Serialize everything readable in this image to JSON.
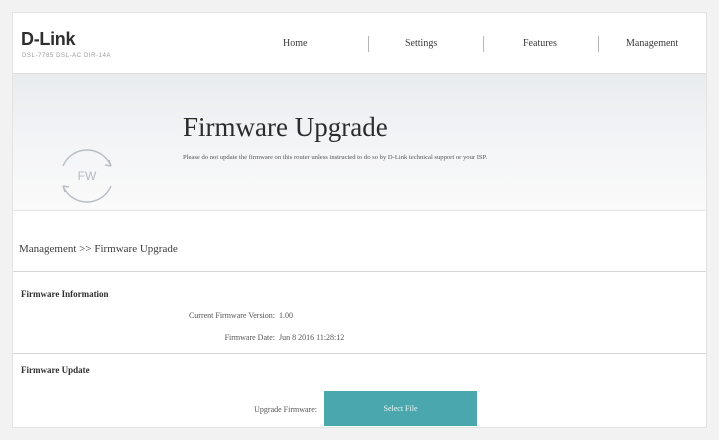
{
  "header": {
    "logo": "D-Link",
    "model": "DSL-7785 DSL-AC DIR-14A",
    "nav": [
      "Home",
      "Settings",
      "Features",
      "Management"
    ]
  },
  "hero": {
    "icon_label": "FW",
    "title": "Firmware Upgrade",
    "description": "Please do not update the firmware on this router unless instructed to do so by D-Link technical support or your ISP."
  },
  "breadcrumb": "Management >> Firmware Upgrade",
  "firmware_info": {
    "title": "Firmware Information",
    "version_label": "Current Firmware Version:",
    "version_value": "1.00",
    "date_label": "Firmware Date:",
    "date_value": "Jun 8 2016 11:28:12"
  },
  "firmware_update": {
    "title": "Firmware Update",
    "upgrade_label": "Upgrade Firmware:",
    "select_button": "Select File"
  },
  "colors": {
    "accent": "#4aa7ad",
    "hero_top": "#e9ecef"
  }
}
